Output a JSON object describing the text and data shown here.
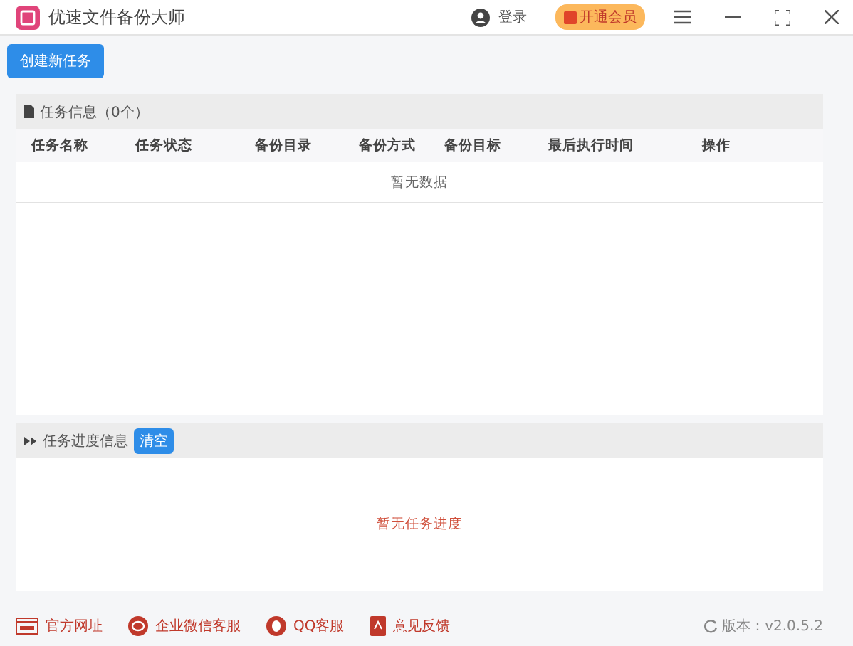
{
  "window": {
    "title": "优速文件备份大师",
    "login": "登录",
    "vip": "开通会员"
  },
  "toolbar": {
    "create_button": "创建新任务"
  },
  "task_panel": {
    "title": "任务信息（0个）",
    "columns": [
      "任务名称",
      "任务状态",
      "备份目录",
      "备份方式",
      "备份目标",
      "最后执行时间",
      "操作"
    ],
    "empty": "暂无数据"
  },
  "progress_panel": {
    "title": "任务进度信息",
    "clear_button": "清空",
    "empty": "暂无任务进度"
  },
  "footer": {
    "links": [
      {
        "kind": "web",
        "label": "官方网址"
      },
      {
        "kind": "wechat",
        "label": "企业微信客服"
      },
      {
        "kind": "qq",
        "label": "QQ客服"
      },
      {
        "kind": "feedback",
        "label": "意见反馈"
      }
    ],
    "version": "版本：v2.0.5.2"
  }
}
